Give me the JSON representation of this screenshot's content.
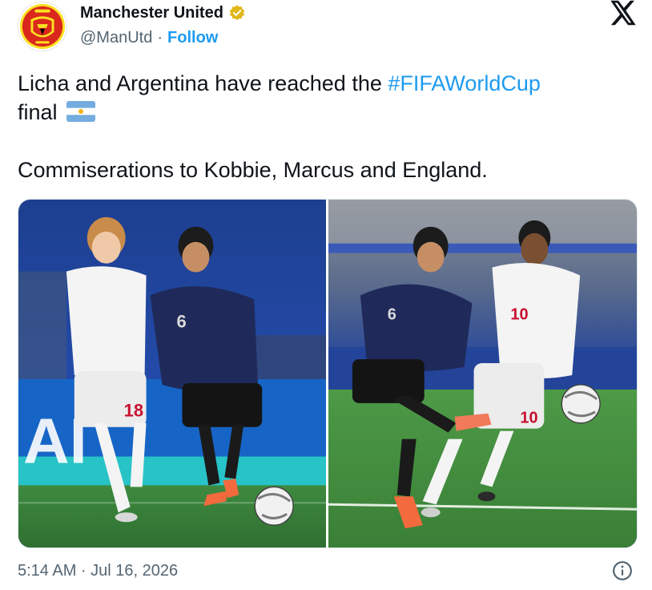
{
  "account": {
    "display_name": "Manchester United",
    "handle": "@ManUtd",
    "separator": "·",
    "follow_label": "Follow",
    "avatar_icon": "man-utd-crest-icon",
    "verified_icon": "verified-gold-badge-icon",
    "verified_color": "#e2b719"
  },
  "platform": {
    "logo_icon": "x-logo-icon"
  },
  "tweet": {
    "line1_text": "Licha and Argentina have reached the ",
    "hashtag": "#FIFAWorldCup",
    "line2_text": "final",
    "flag_icon": "argentina-flag-emoji",
    "line3_text": "Commiserations to Kobbie, Marcus and England."
  },
  "media": {
    "photos": [
      {
        "label": "photo-left",
        "kit_numbers": [
          "6",
          "18"
        ]
      },
      {
        "label": "photo-right",
        "kit_numbers": [
          "6",
          "10"
        ]
      }
    ]
  },
  "meta": {
    "timestamp": "5:14 AM · Jul 16, 2026",
    "info_icon": "info-circle-icon"
  },
  "colors": {
    "link": "#1d9bf0",
    "text": "#0f1419",
    "muted": "#536471"
  }
}
